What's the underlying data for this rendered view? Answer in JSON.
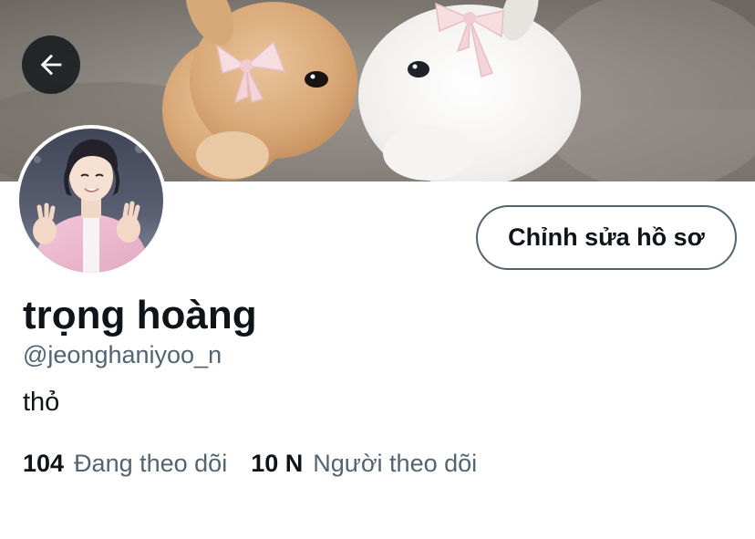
{
  "profile": {
    "edit_label": "Chỉnh sửa hồ sơ",
    "display_name": "trọng hoàng",
    "handle": "@jeonghaniyoo_n",
    "bio": "thỏ"
  },
  "stats": {
    "following": {
      "value": "104",
      "label": "Đang theo dõi"
    },
    "followers": {
      "value": "10 N",
      "label": "Người theo dõi"
    }
  },
  "icons": {
    "back": "arrow-left-icon"
  },
  "colors": {
    "text_primary": "#0f1419",
    "text_secondary": "#536471",
    "button_border": "#536471",
    "back_button_bg": "#0f1419"
  }
}
